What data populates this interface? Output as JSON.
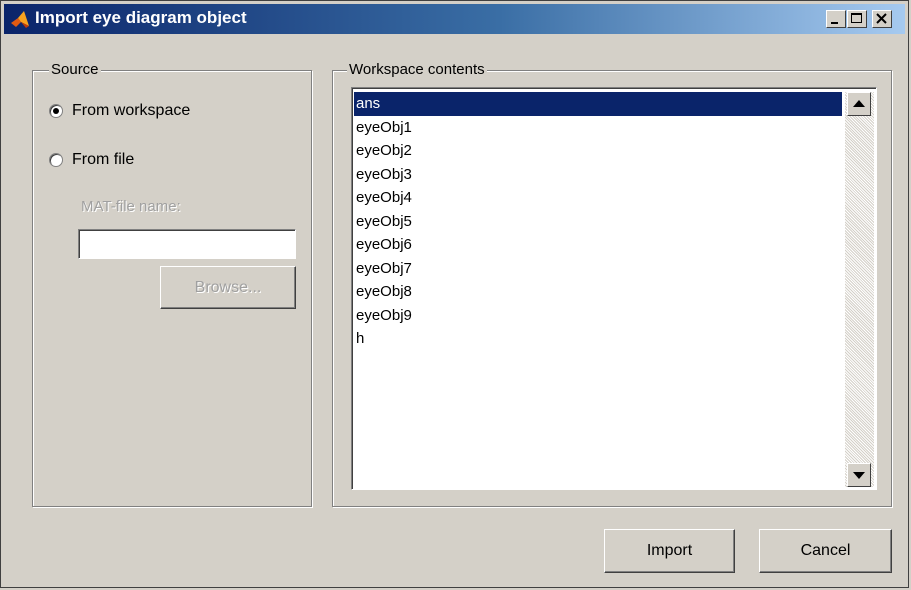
{
  "window": {
    "title": "Import eye diagram object"
  },
  "source": {
    "legend": "Source",
    "radio_workspace": {
      "label": "From workspace",
      "selected": true
    },
    "radio_file": {
      "label": "From file",
      "selected": false
    },
    "mat_label": "MAT-file name:",
    "mat_value": "",
    "browse_label": "Browse..."
  },
  "workspace": {
    "legend": "Workspace contents",
    "items": [
      "ans",
      "eyeObj1",
      "eyeObj2",
      "eyeObj3",
      "eyeObj4",
      "eyeObj5",
      "eyeObj6",
      "eyeObj7",
      "eyeObj8",
      "eyeObj9",
      "h"
    ],
    "selected_item": "ans"
  },
  "buttons": {
    "import_label": "Import",
    "cancel_label": "Cancel"
  },
  "colors": {
    "title_gradient_start": "#0a246a",
    "selection": "#0a246a",
    "face": "#d4d0c8"
  },
  "icons": [
    "matlab-logo-icon",
    "minimize-icon",
    "maximize-icon",
    "close-icon",
    "scroll-up-arrow-icon",
    "scroll-down-arrow-icon"
  ]
}
